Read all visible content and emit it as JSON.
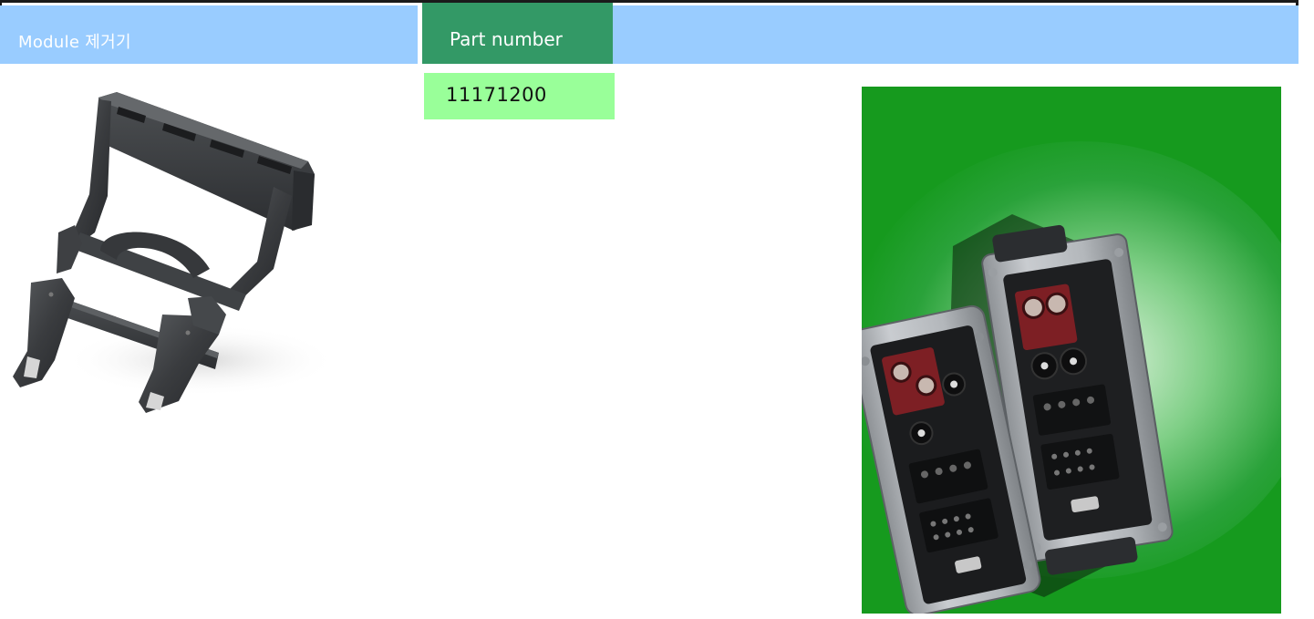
{
  "header": {
    "title": "Module 제거기",
    "tab_label": "Part number"
  },
  "part": {
    "number": "11171200"
  },
  "colors": {
    "header_bg": "#99ccff",
    "tab_bg": "#339966",
    "value_bg": "#99ff99",
    "photo_bg": "#169a1e"
  },
  "images": {
    "product": "module-extractor-tool",
    "photo": "industrial-connector-modules"
  }
}
